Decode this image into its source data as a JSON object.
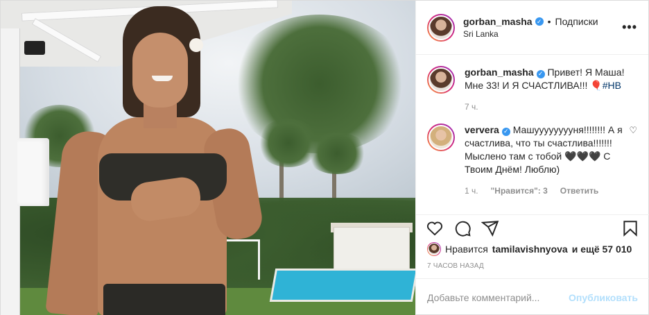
{
  "post": {
    "username": "gorban_masha",
    "follow_label": "Подписки",
    "dot": "•",
    "location": "Sri Lanka",
    "more_icon": "more-horizontal-icon"
  },
  "caption": {
    "username": "gorban_masha",
    "text": "Привет! Я Маша! Мне 33! И Я СЧАСТЛИВА!!! 🎈",
    "hashtag": "#HB",
    "time": "7 ч."
  },
  "comment": {
    "username": "ververa",
    "text": "Машууууууууня!!!!!!!! А я счастлива, что ты счастлива!!!!!!! Мыслено там с тобой 🖤🖤🖤 С Твоим Днём! Люблю)",
    "time": "1 ч.",
    "likes_label": "\"Нравится\": 3",
    "reply_label": "Ответить"
  },
  "likes": {
    "prefix": "Нравится",
    "user": "tamilavishnyova",
    "suffix": "и ещё 57 010"
  },
  "timestamp": "7 ЧАСОВ НАЗАД",
  "add_comment": {
    "placeholder": "Добавьте комментарий...",
    "publish_label": "Опубликовать"
  },
  "colors": {
    "verified": "#3897f0",
    "publish": "#b2dffc",
    "hashtag": "#003569"
  }
}
